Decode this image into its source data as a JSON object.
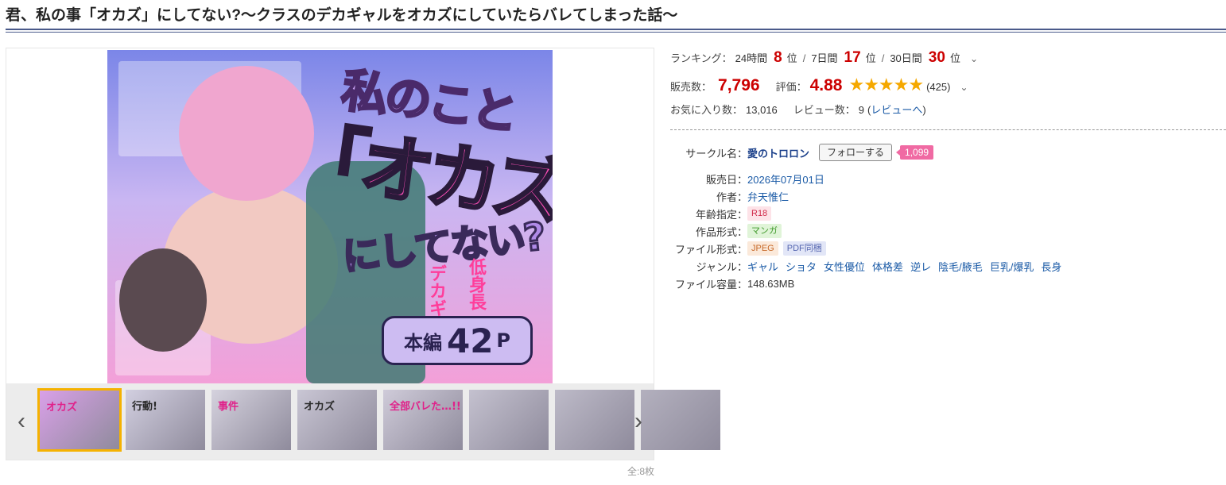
{
  "title": "君、私の事「オカズ」にしてない?〜クラスのデカギャルをオカズにしていたらバレてしまった話〜",
  "cover": {
    "line1": "私のこと",
    "line2": "「オカズ」",
    "line3": "にしてない?",
    "side1": "デカギャル",
    "side2": "低身長",
    "pages_a": "本編",
    "pages_b": "42",
    "pages_c": "P"
  },
  "gallery": {
    "prev": "‹",
    "next": "›",
    "count_label": "全:8枚",
    "thumbs": [
      {
        "text": "オカズ",
        "selected": true,
        "color": "#d9a0e8"
      },
      {
        "text": "行動!",
        "selected": false,
        "color": "#d2cfe0"
      },
      {
        "text": "事件",
        "selected": false,
        "color": "#d5d2de"
      },
      {
        "text": "オカズ",
        "selected": false,
        "color": "#c9c6d4"
      },
      {
        "text": "全部バレた…!!",
        "selected": false,
        "color": "#cfcbd9"
      },
      {
        "text": "",
        "selected": false,
        "color": "#c4c1cf"
      },
      {
        "text": "",
        "selected": false,
        "color": "#bdbac8"
      },
      {
        "text": "",
        "selected": false,
        "color": "#b3b0be"
      }
    ]
  },
  "ranking": {
    "label": "ランキング：",
    "d24_label": "24時間",
    "d24_value": "8",
    "d7_label": "7日間",
    "d7_value": "17",
    "d30_label": "30日間",
    "d30_value": "30",
    "unit": "位",
    "sep": "/"
  },
  "sales": {
    "label": "販売数：",
    "value": "7,796",
    "rating_label": "評価：",
    "rating_value": "4.88",
    "stars": "★★★★★",
    "rating_count": "(425)"
  },
  "favorites": {
    "label": "お気に入り数：",
    "value": "13,016",
    "review_label": "レビュー数：",
    "review_value": "9",
    "review_link_open": "(",
    "review_link": "レビューへ",
    "review_link_close": ")"
  },
  "details": {
    "circle_label": "サークル名：",
    "circle_name": "愛のトロロン",
    "follow_button": "フォローする",
    "follow_count": "1,099",
    "release_label": "販売日：",
    "release_date": "2026年07月01日",
    "author_label": "作者：",
    "author": "弁天惟仁",
    "age_label": "年齢指定：",
    "age_tag": "R18",
    "format_label": "作品形式：",
    "format_tag": "マンガ",
    "file_format_label": "ファイル形式：",
    "file_tag1": "JPEG",
    "file_tag2": "PDF同梱",
    "genre_label": "ジャンル：",
    "genres": [
      "ギャル",
      "ショタ",
      "女性優位",
      "体格差",
      "逆レ",
      "陰毛/腋毛",
      "巨乳/爆乳",
      "長身"
    ],
    "size_label": "ファイル容量：",
    "size": "148.63MB"
  },
  "colors": {
    "rank_red": "#cc0000",
    "link_blue": "#1a5aa6",
    "star_gold": "#f5a800",
    "follow_pink": "#f06aa3"
  }
}
